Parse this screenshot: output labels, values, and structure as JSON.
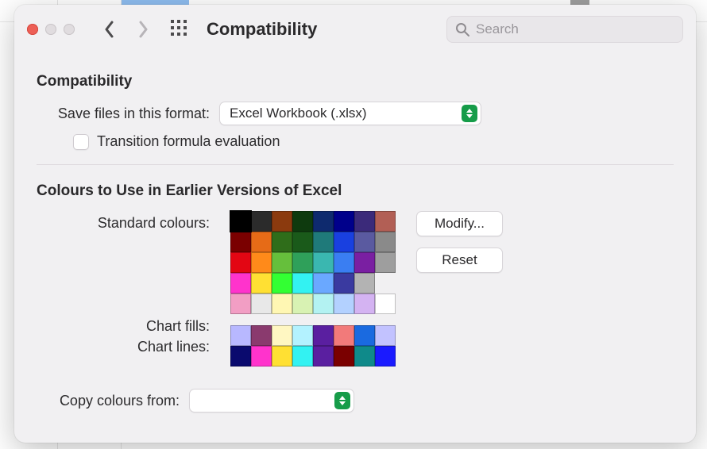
{
  "window": {
    "title": "Compatibility"
  },
  "search": {
    "placeholder": "Search",
    "value": ""
  },
  "sections": {
    "compat_title": "Compatibility",
    "save_label": "Save files in this format:",
    "save_format": "Excel Workbook (.xlsx)",
    "transition_label": "Transition formula evaluation",
    "transition_checked": false,
    "colors_title": "Colours to Use in Earlier Versions of Excel",
    "standard_label": "Standard colours:",
    "chartfills_label": "Chart fills:",
    "chartlines_label": "Chart lines:",
    "copyfrom_label": "Copy colours from:",
    "copyfrom_value": ""
  },
  "buttons": {
    "modify": "Modify...",
    "reset": "Reset"
  },
  "palette": {
    "standard": [
      [
        "#000000",
        "#2b2b2b",
        "#8b3a0e",
        "#0e3a0e",
        "#0e2a6e",
        "#00008b",
        "#3b2a7a",
        "#b25f55",
        "#f2b98f"
      ],
      [
        "#7a0000",
        "#e66b17",
        "#2f6d1a",
        "#1a5a1a",
        "#1f7a7a",
        "#1940e0",
        "#5a5aa0",
        "#8a8a8a"
      ],
      [
        "#e30613",
        "#ff8a1a",
        "#66bf3c",
        "#2fa05a",
        "#3ab7b0",
        "#3a7ef2",
        "#7a1fa2",
        "#9e9e9e"
      ],
      [
        "#ff33cc",
        "#ffe033",
        "#33ff33",
        "#33f2f2",
        "#6aa8ff",
        "#3a3aa0",
        "#b3b3b3"
      ],
      [
        "#f29ec4",
        "#e8e8e8",
        "#fff7b3",
        "#d8f2b3",
        "#b3f2f2",
        "#b3d1ff",
        "#d4b3f2",
        "#ffffff"
      ]
    ],
    "standard_row0_selected_index": 0,
    "chart_fills": [
      "#b8b8ff",
      "#8a3a6e",
      "#fff7c2",
      "#b3f2ff",
      "#5a1fa0",
      "#f27a7a",
      "#1a6ae0",
      "#c2c2ff"
    ],
    "chart_lines": [
      "#0a0a6e",
      "#ff33cc",
      "#ffe033",
      "#33f2f2",
      "#5a1fa0",
      "#7a0000",
      "#0f8a8a",
      "#1a1aff"
    ]
  }
}
